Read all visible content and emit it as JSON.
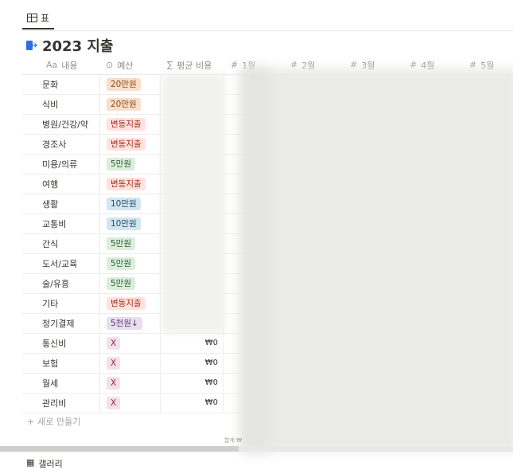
{
  "view_tabs": [
    {
      "label": "표",
      "icon": "table-icon"
    }
  ],
  "title": {
    "icon": "exit-icon",
    "text": "2023 지출"
  },
  "columns": {
    "name": {
      "glyph": "Aa",
      "label": "내용"
    },
    "budget": {
      "glyph": "⊙",
      "label": "예산"
    },
    "avg": {
      "glyph": "∑",
      "label": "평균 비용"
    },
    "months": [
      {
        "glyph": "#",
        "label": "1월"
      },
      {
        "glyph": "#",
        "label": "2월"
      },
      {
        "glyph": "#",
        "label": "3월"
      },
      {
        "glyph": "#",
        "label": "4월"
      },
      {
        "glyph": "#",
        "label": "5월"
      }
    ]
  },
  "rows": [
    {
      "name": "문화",
      "budget": "20만원",
      "budget_bg": "#fadec9",
      "budget_fg": "#8a4a1d",
      "avg": ""
    },
    {
      "name": "식비",
      "budget": "20만원",
      "budget_bg": "#fadec9",
      "budget_fg": "#8a4a1d",
      "avg": ""
    },
    {
      "name": "병원/건강/약",
      "budget": "변동지출",
      "budget_bg": "#ffe2dd",
      "budget_fg": "#9f2d1e",
      "avg": ""
    },
    {
      "name": "경조사",
      "budget": "변동지출",
      "budget_bg": "#ffe2dd",
      "budget_fg": "#9f2d1e",
      "avg": ""
    },
    {
      "name": "미용/의류",
      "budget": "5만원",
      "budget_bg": "#dbeddb",
      "budget_fg": "#2b5e39",
      "avg": ""
    },
    {
      "name": "여행",
      "budget": "변동지출",
      "budget_bg": "#ffe2dd",
      "budget_fg": "#9f2d1e",
      "avg": ""
    },
    {
      "name": "생활",
      "budget": "10만원",
      "budget_bg": "#d3e5ef",
      "budget_fg": "#1f4e6e",
      "avg": ""
    },
    {
      "name": "교통비",
      "budget": "10만원",
      "budget_bg": "#d3e5ef",
      "budget_fg": "#1f4e6e",
      "avg": ""
    },
    {
      "name": "간식",
      "budget": "5만원",
      "budget_bg": "#dbeddb",
      "budget_fg": "#2b5e39",
      "avg": ""
    },
    {
      "name": "도서/교육",
      "budget": "5만원",
      "budget_bg": "#dbeddb",
      "budget_fg": "#2b5e39",
      "avg": ""
    },
    {
      "name": "술/유흥",
      "budget": "5만원",
      "budget_bg": "#dbeddb",
      "budget_fg": "#2b5e39",
      "avg": ""
    },
    {
      "name": "기타",
      "budget": "변동지출",
      "budget_bg": "#ffe2dd",
      "budget_fg": "#9f2d1e",
      "avg": ""
    },
    {
      "name": "정기결제",
      "budget": "5천원↓",
      "budget_bg": "#e8deee",
      "budget_fg": "#5a3a7a",
      "avg": ""
    },
    {
      "name": "통신비",
      "budget": "X",
      "budget_bg": "#f5e0e9",
      "budget_fg": "#8a2a55",
      "avg": "₩0"
    },
    {
      "name": "보험",
      "budget": "X",
      "budget_bg": "#f5e0e9",
      "budget_fg": "#8a2a55",
      "avg": "₩0"
    },
    {
      "name": "월세",
      "budget": "X",
      "budget_bg": "#f5e0e9",
      "budget_fg": "#8a2a55",
      "avg": "₩0"
    },
    {
      "name": "관리비",
      "budget": "X",
      "budget_bg": "#f5e0e9",
      "budget_fg": "#8a2a55",
      "avg": "₩0"
    }
  ],
  "new_row": {
    "icon": "+",
    "label": "새로 만들기"
  },
  "calc_row": {
    "label": "합계 ₩"
  },
  "gallery": {
    "icon": "gallery-icon",
    "label": "갤러리"
  }
}
